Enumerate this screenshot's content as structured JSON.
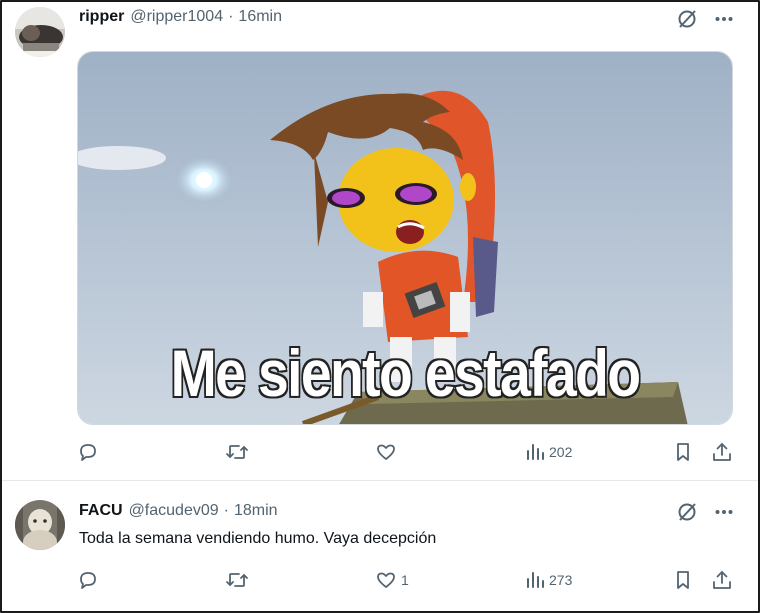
{
  "tweets": [
    {
      "name": "ripper",
      "handle": "@ripper1004",
      "separator": "·",
      "time": "16min",
      "media_caption": "Me siento estafado",
      "reply_count": "",
      "retweet_count": "",
      "like_count": "",
      "views": "202"
    },
    {
      "name": "FACU",
      "handle": "@facudev09",
      "separator": "·",
      "time": "18min",
      "text": "Toda la semana vendiendo humo. Vaya decepción",
      "reply_count": "",
      "retweet_count": "",
      "like_count": "1",
      "views": "273"
    }
  ],
  "icons": {
    "grok": "grok-slash-icon",
    "more": "more-dots-icon",
    "reply": "reply-bubble-icon",
    "retweet": "retweet-arrows-icon",
    "like": "heart-icon",
    "views": "views-bars-icon",
    "bookmark": "bookmark-icon",
    "share": "share-upload-icon"
  },
  "colors": {
    "text_primary": "#0f1419",
    "text_secondary": "#536471",
    "divider": "#e6e9ec"
  }
}
